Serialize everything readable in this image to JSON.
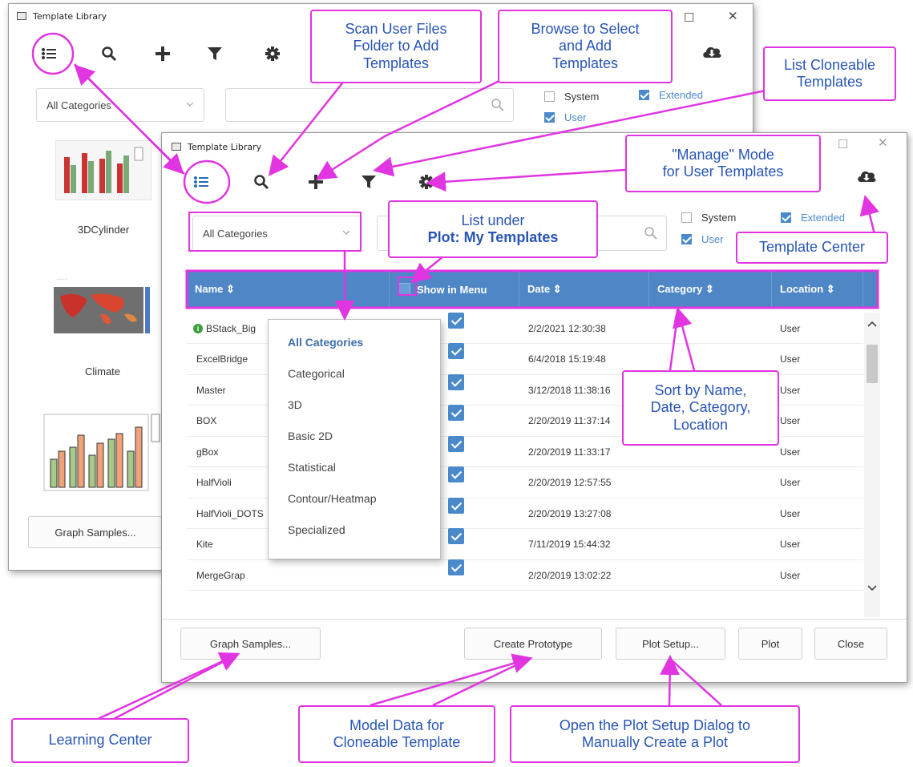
{
  "back_window": {
    "title": "Template Library",
    "category_select": "All Categories",
    "cb_system": "System",
    "cb_extended": "Extended",
    "cb_user": "User",
    "thumbs": [
      {
        "label": "3DCylinder"
      },
      {
        "label": "Climate"
      },
      {
        "label": ""
      }
    ],
    "graph_samples": "Graph Samples..."
  },
  "front_window": {
    "title": "Template Library",
    "category_select": "All Categories",
    "cb_system": "System",
    "cb_extended": "Extended",
    "cb_user": "User",
    "columns": [
      "Name ⇕",
      "Show in Menu",
      "Date ⇕",
      "Category ⇕",
      "Location ⇕"
    ],
    "rows": [
      {
        "name": "BStack_Big",
        "date": "2/2/2021 12:30:38",
        "location": "User"
      },
      {
        "name": "ExcelBridge",
        "date": "6/4/2018 15:19:48",
        "location": "User"
      },
      {
        "name": "Master",
        "date": "3/12/2018 11:38:16",
        "location": "User"
      },
      {
        "name": "BOX",
        "date": "2/20/2019 11:37:14",
        "location": "User"
      },
      {
        "name": "gBox",
        "date": "2/20/2019 11:33:17",
        "location": "User"
      },
      {
        "name": "HalfVioli",
        "date": "2/20/2019 12:57:55",
        "location": "User"
      },
      {
        "name": "HalfVioli_DOTS",
        "date": "2/20/2019 13:27:08",
        "location": "User"
      },
      {
        "name": "Kite",
        "date": "7/11/2019 15:44:32",
        "location": "User"
      },
      {
        "name": "MergeGrap",
        "date": "2/20/2019 13:02:22",
        "location": "User"
      }
    ],
    "dropdown": [
      "All Categories",
      "Categorical",
      "3D",
      "Basic 2D",
      "Statistical",
      "Contour/Heatmap",
      "Specialized"
    ],
    "buttons": {
      "graph_samples": "Graph Samples...",
      "create_prototype": "Create Prototype",
      "plot_setup": "Plot Setup...",
      "plot": "Plot",
      "close": "Close"
    }
  },
  "callouts": {
    "scan": "Scan User Files\nFolder to Add\nTemplates",
    "browse": "Browse to Select\nand Add\nTemplates",
    "cloneable": "List Cloneable\nTemplates",
    "manage": "\"Manage\" Mode\nfor User Templates",
    "list_under_line1": "List under",
    "list_under_line2": "Plot: My Templates",
    "template_center": "Template Center",
    "sort": "Sort by Name,\nDate, Category,\nLocation",
    "learning": "Learning Center",
    "model": "Model Data for\nCloneable Template",
    "open_plot": "Open the Plot Setup Dialog to\nManually Create a Plot"
  },
  "colors": {
    "accent": "#4f86c6",
    "callout_border": "#e035e0",
    "callout_text": "#2855b5"
  }
}
